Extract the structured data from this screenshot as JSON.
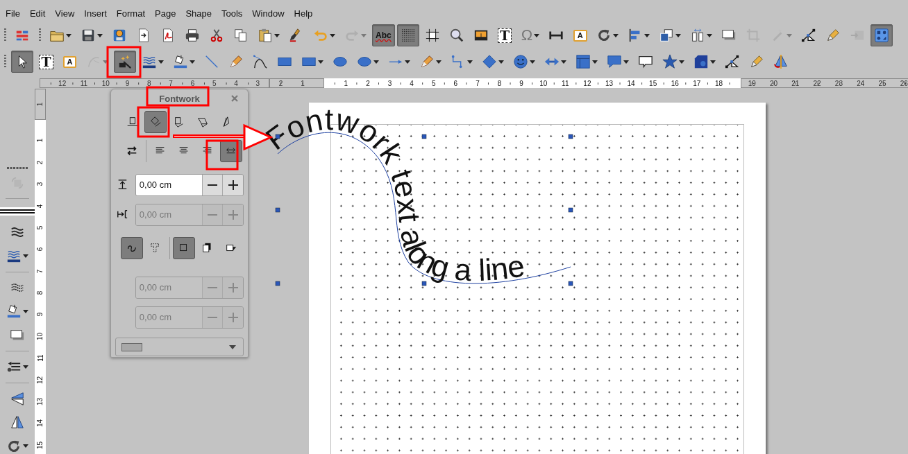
{
  "menu": [
    "File",
    "Edit",
    "View",
    "Insert",
    "Format",
    "Page",
    "Shape",
    "Tools",
    "Window",
    "Help"
  ],
  "toolbar_rows": [
    {
      "toolbars": [
        {
          "items": [
            {
              "kind": "sidebar",
              "pressed": false,
              "disabled": false,
              "dropdown": false
            }
          ]
        },
        {
          "items": [
            {
              "kind": "open",
              "pressed": false,
              "disabled": false,
              "dropdown": true
            },
            {
              "kind": "save",
              "pressed": false,
              "disabled": false,
              "dropdown": true
            },
            {
              "kind": "save-remote",
              "pressed": false,
              "disabled": false,
              "dropdown": false
            },
            {
              "kind": "export",
              "pressed": false,
              "disabled": false,
              "dropdown": false
            },
            {
              "kind": "pdf",
              "pressed": false,
              "disabled": false,
              "dropdown": false
            },
            {
              "kind": "print",
              "pressed": false,
              "disabled": false,
              "dropdown": false
            },
            {
              "kind": "cut",
              "pressed": false,
              "disabled": false,
              "dropdown": false
            },
            {
              "kind": "copy",
              "pressed": false,
              "disabled": false,
              "dropdown": false
            },
            {
              "kind": "paste",
              "pressed": false,
              "disabled": false,
              "dropdown": true
            },
            {
              "kind": "brush",
              "pressed": false,
              "disabled": false,
              "dropdown": false
            },
            {
              "kind": "undo",
              "pressed": false,
              "disabled": false,
              "dropdown": true
            },
            {
              "kind": "redo",
              "pressed": false,
              "disabled": true,
              "dropdown": true
            },
            {
              "kind": "spelling",
              "label": "Abc",
              "pressed": true,
              "disabled": false,
              "dropdown": false
            },
            {
              "kind": "grid",
              "pressed": true,
              "disabled": false,
              "dropdown": false
            },
            {
              "kind": "snaplines",
              "pressed": false,
              "disabled": false,
              "dropdown": false
            },
            {
              "kind": "zoom",
              "pressed": false,
              "disabled": false,
              "dropdown": false
            },
            {
              "kind": "image",
              "pressed": false,
              "disabled": false,
              "dropdown": false
            },
            {
              "kind": "text-frame",
              "label": "T",
              "pressed": false,
              "disabled": false,
              "dropdown": false
            },
            {
              "kind": "special-character",
              "label": "Ω",
              "pressed": false,
              "disabled": false,
              "dropdown": true
            },
            {
              "kind": "dimension",
              "pressed": false,
              "disabled": false,
              "dropdown": false
            },
            {
              "kind": "label-frame",
              "label": "A",
              "pressed": false,
              "disabled": false,
              "dropdown": false
            },
            {
              "kind": "rotate",
              "pressed": false,
              "disabled": false,
              "dropdown": true
            },
            {
              "kind": "align",
              "pressed": false,
              "disabled": false,
              "dropdown": true
            },
            {
              "kind": "arrange",
              "pressed": false,
              "disabled": false,
              "dropdown": true
            },
            {
              "kind": "distribute",
              "pressed": false,
              "disabled": false,
              "dropdown": true
            },
            {
              "kind": "shadow",
              "pressed": false,
              "disabled": false,
              "dropdown": false
            },
            {
              "kind": "crop",
              "pressed": false,
              "disabled": true,
              "dropdown": false
            },
            {
              "kind": "wand",
              "pressed": false,
              "disabled": true,
              "dropdown": true
            },
            {
              "kind": "points",
              "pressed": false,
              "disabled": false,
              "dropdown": false
            },
            {
              "kind": "glue",
              "pressed": false,
              "disabled": false,
              "dropdown": false
            },
            {
              "kind": "insert",
              "pressed": false,
              "disabled": true,
              "dropdown": false
            },
            {
              "kind": "display-grid",
              "pressed": true,
              "disabled": false,
              "dropdown": false
            }
          ]
        }
      ]
    },
    {
      "toolbars": [
        {
          "items": [
            {
              "kind": "select",
              "pressed": true,
              "disabled": false,
              "dropdown": false
            },
            {
              "kind": "text-frame",
              "label": "T",
              "pressed": false,
              "disabled": false,
              "dropdown": false
            },
            {
              "kind": "label-frame",
              "label": "A",
              "pressed": false,
              "disabled": false,
              "dropdown": false
            },
            {
              "kind": "curve",
              "pressed": false,
              "disabled": true,
              "dropdown": true
            },
            {
              "kind": "fontwork",
              "pressed": true,
              "disabled": false,
              "dropdown": false
            },
            {
              "kind": "line-style",
              "pressed": false,
              "disabled": false,
              "dropdown": true
            },
            {
              "kind": "fill",
              "pressed": false,
              "disabled": false,
              "dropdown": true
            },
            {
              "kind": "line",
              "pressed": false,
              "disabled": false,
              "dropdown": false
            },
            {
              "kind": "pencil",
              "pressed": false,
              "disabled": false,
              "dropdown": false
            },
            {
              "kind": "bezier",
              "pressed": false,
              "disabled": false,
              "dropdown": false
            },
            {
              "kind": "rect",
              "pressed": false,
              "disabled": false,
              "dropdown": false
            },
            {
              "kind": "rect",
              "pressed": false,
              "disabled": false,
              "dropdown": true
            },
            {
              "kind": "ellipse",
              "pressed": false,
              "disabled": false,
              "dropdown": false
            },
            {
              "kind": "ellipse",
              "pressed": false,
              "disabled": false,
              "dropdown": true
            },
            {
              "kind": "arrow",
              "pressed": false,
              "disabled": false,
              "dropdown": true
            },
            {
              "kind": "pencil",
              "pressed": false,
              "disabled": false,
              "dropdown": true
            },
            {
              "kind": "connector",
              "pressed": false,
              "disabled": false,
              "dropdown": true
            },
            {
              "kind": "diamond",
              "pressed": false,
              "disabled": false,
              "dropdown": true
            },
            {
              "kind": "smiley",
              "pressed": false,
              "disabled": false,
              "dropdown": true
            },
            {
              "kind": "double-arrow",
              "pressed": false,
              "disabled": false,
              "dropdown": true
            },
            {
              "kind": "flowchart",
              "pressed": false,
              "disabled": false,
              "dropdown": true
            },
            {
              "kind": "callout",
              "pressed": false,
              "disabled": false,
              "dropdown": true
            },
            {
              "kind": "callout-outline",
              "pressed": false,
              "disabled": false,
              "dropdown": false
            },
            {
              "kind": "star",
              "pressed": false,
              "disabled": false,
              "dropdown": true
            },
            {
              "kind": "extrusion",
              "pressed": false,
              "disabled": false,
              "dropdown": true
            },
            {
              "kind": "points",
              "pressed": false,
              "disabled": false,
              "dropdown": false
            },
            {
              "kind": "glue",
              "pressed": false,
              "disabled": false,
              "dropdown": false
            },
            {
              "kind": "mirror",
              "pressed": false,
              "disabled": false,
              "dropdown": false
            }
          ]
        }
      ]
    }
  ],
  "sidebar": {
    "groups": [
      {
        "items": [
          {
            "kind": "transform",
            "disabled": true,
            "dropdown": false
          }
        ]
      },
      {
        "items": [
          {
            "kind": "line-preview",
            "disabled": false
          },
          {
            "kind": "waves",
            "disabled": false,
            "dropdown": false
          },
          {
            "kind": "line-style",
            "disabled": false,
            "dropdown": true
          }
        ]
      },
      {
        "items": [
          {
            "kind": "waves-dotted",
            "disabled": false,
            "dropdown": false
          },
          {
            "kind": "fill",
            "disabled": false,
            "dropdown": true
          },
          {
            "kind": "shadow",
            "disabled": false,
            "dropdown": false
          }
        ]
      },
      {
        "items": [
          {
            "kind": "line-ends",
            "disabled": false,
            "dropdown": true
          }
        ]
      },
      {
        "items": [
          {
            "kind": "flip-vertical",
            "disabled": false,
            "dropdown": false
          },
          {
            "kind": "flip-horizontal",
            "disabled": false,
            "dropdown": false
          },
          {
            "kind": "rotate",
            "disabled": false,
            "dropdown": true
          }
        ]
      }
    ]
  },
  "ruler_horizontal": [
    {
      "kind": "outside",
      "labels": [
        "12",
        "11",
        "10",
        "9",
        "8",
        "7",
        "6",
        "5",
        "4",
        "3"
      ]
    },
    {
      "kind": "margin",
      "labels": [
        "2",
        "1"
      ]
    },
    {
      "kind": "page",
      "labels": [
        "1",
        "2",
        "3",
        "4",
        "5",
        "6",
        "7",
        "8",
        "9",
        "10",
        "11",
        "12",
        "13",
        "14",
        "15",
        "16",
        "17",
        "18"
      ]
    },
    {
      "kind": "outside",
      "labels": [
        "19",
        "20",
        "21",
        "22",
        "23",
        "24",
        "25",
        "26"
      ]
    }
  ],
  "ruler_vertical": [
    {
      "kind": "margin",
      "labels": [
        "1"
      ]
    },
    {
      "kind": "page",
      "labels": [
        "1",
        "2",
        "3",
        "4",
        "5",
        "6",
        "7",
        "8",
        "9",
        "10",
        "11",
        "12",
        "13",
        "14",
        "15"
      ]
    }
  ],
  "drawing": {
    "fontwork_text": "Fontwork text along a line",
    "selected": true
  },
  "fontwork_panel": {
    "title": "Fontwork",
    "shape_buttons": [
      {
        "kind": "off",
        "selected": false
      },
      {
        "kind": "rotate",
        "selected": true
      },
      {
        "kind": "upright",
        "selected": false
      },
      {
        "kind": "slant-horizontal",
        "selected": false
      },
      {
        "kind": "slant-vertical",
        "selected": false
      }
    ],
    "orientation": {
      "selected": false
    },
    "alignment": [
      {
        "kind": "left",
        "selected": false
      },
      {
        "kind": "center",
        "selected": false
      },
      {
        "kind": "right",
        "selected": false
      },
      {
        "kind": "autosize",
        "selected": true
      }
    ],
    "fields": [
      {
        "kind": "distance",
        "value": "0,00 cm",
        "disabled": false
      },
      {
        "kind": "indent",
        "value": "0,00 cm",
        "disabled": true
      }
    ],
    "contour": [
      {
        "kind": "contour",
        "selected": true
      },
      {
        "kind": "text-frame",
        "selected": false
      }
    ],
    "shadow": [
      {
        "kind": "none",
        "selected": true
      },
      {
        "kind": "vertical",
        "selected": false
      },
      {
        "kind": "slant",
        "selected": false
      }
    ],
    "shadow_fields": [
      {
        "value": "0,00 cm",
        "disabled": true
      },
      {
        "value": "0,00 cm",
        "disabled": true
      }
    ],
    "shadow_color": {
      "disabled": true
    }
  }
}
